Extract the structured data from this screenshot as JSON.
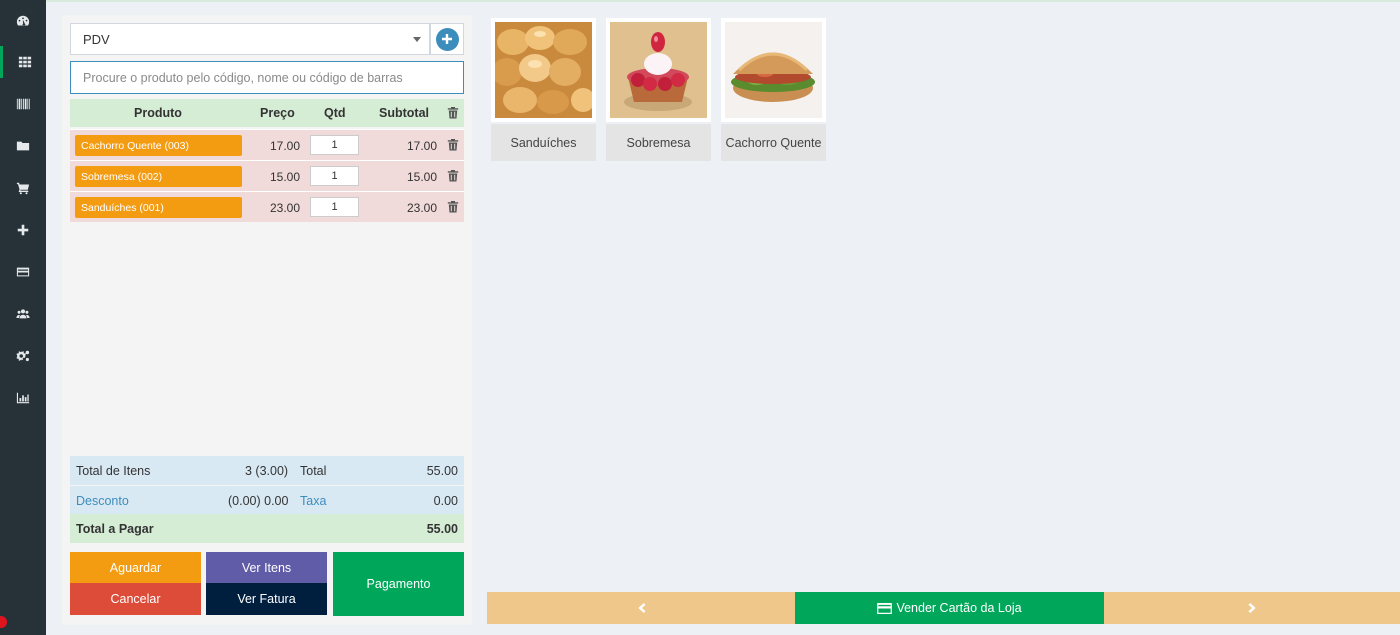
{
  "sidebar": {
    "items": [
      {
        "icon": "dashboard-icon"
      },
      {
        "icon": "grid-icon"
      },
      {
        "icon": "barcode-icon"
      },
      {
        "icon": "folder-icon"
      },
      {
        "icon": "cart-icon"
      },
      {
        "icon": "plus-icon"
      },
      {
        "icon": "credit-card-icon"
      },
      {
        "icon": "users-icon"
      },
      {
        "icon": "cogs-icon"
      },
      {
        "icon": "bar-chart-icon"
      }
    ]
  },
  "pos": {
    "register_select": "PDV",
    "search_placeholder": "Procure o produto pelo código, nome ou código de barras",
    "table": {
      "headers": {
        "product": "Produto",
        "price": "Preço",
        "qty": "Qtd",
        "subtotal": "Subtotal"
      },
      "rows": [
        {
          "product": "Cachorro Quente (003)",
          "price": "17.00",
          "qty": "1",
          "subtotal": "17.00"
        },
        {
          "product": "Sobremesa (002)",
          "price": "15.00",
          "qty": "1",
          "subtotal": "15.00"
        },
        {
          "product": "Sanduíches (001)",
          "price": "23.00",
          "qty": "1",
          "subtotal": "23.00"
        }
      ]
    },
    "totals": {
      "items_label": "Total de Itens",
      "items_value": "3 (3.00)",
      "total_label": "Total",
      "total_value": "55.00",
      "discount_label": "Desconto",
      "discount_value": "(0.00) 0.00",
      "tax_label": "Taxa",
      "tax_value": "0.00",
      "payable_label": "Total a Pagar",
      "payable_value": "55.00"
    },
    "buttons": {
      "hold": "Aguardar",
      "cancel": "Cancelar",
      "view_items": "Ver Itens",
      "view_invoice": "Ver Fatura",
      "payment": "Pagamento"
    }
  },
  "categories": [
    {
      "name": "Sanduíches"
    },
    {
      "name": "Sobremesa"
    },
    {
      "name": "Cachorro Quente"
    }
  ],
  "bottom_bar": {
    "sell_gift_card": "Vender Cartão da Loja"
  },
  "colors": {
    "sidebar_bg": "#263238",
    "accent_green": "#00a65a",
    "orange": "#f39c12",
    "red": "#dd4b39",
    "purple": "#605ca8",
    "navy": "#001f3f",
    "blue": "#3c8dbc",
    "bottom_bar": "#f0c78a"
  }
}
